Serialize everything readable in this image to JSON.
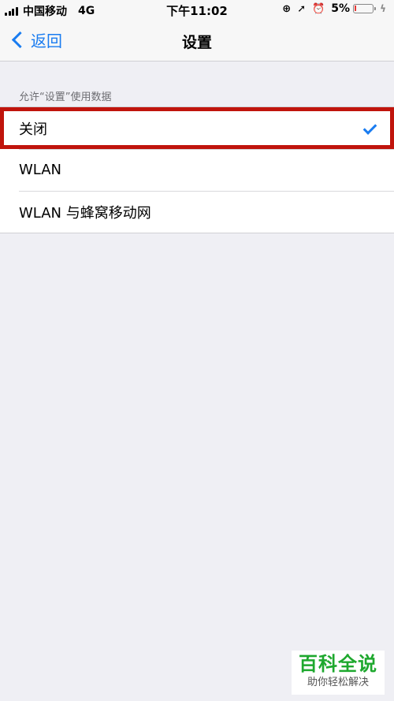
{
  "status_bar": {
    "carrier": "中国移动",
    "network": "4G",
    "time": "下午11:02",
    "battery": "5%"
  },
  "nav": {
    "back_label": "返回",
    "title": "设置"
  },
  "section": {
    "header": "允许“设置”使用数据",
    "options": [
      "关闭",
      "WLAN",
      "WLAN 与蜂窝移动网"
    ],
    "selected": "关闭"
  },
  "watermark": {
    "title": "百科全说",
    "subtitle": "助你轻松解决"
  },
  "colors": {
    "accent": "#1a7cf0",
    "highlight_border": "#c0140c",
    "watermark_green": "#1ea82e"
  }
}
